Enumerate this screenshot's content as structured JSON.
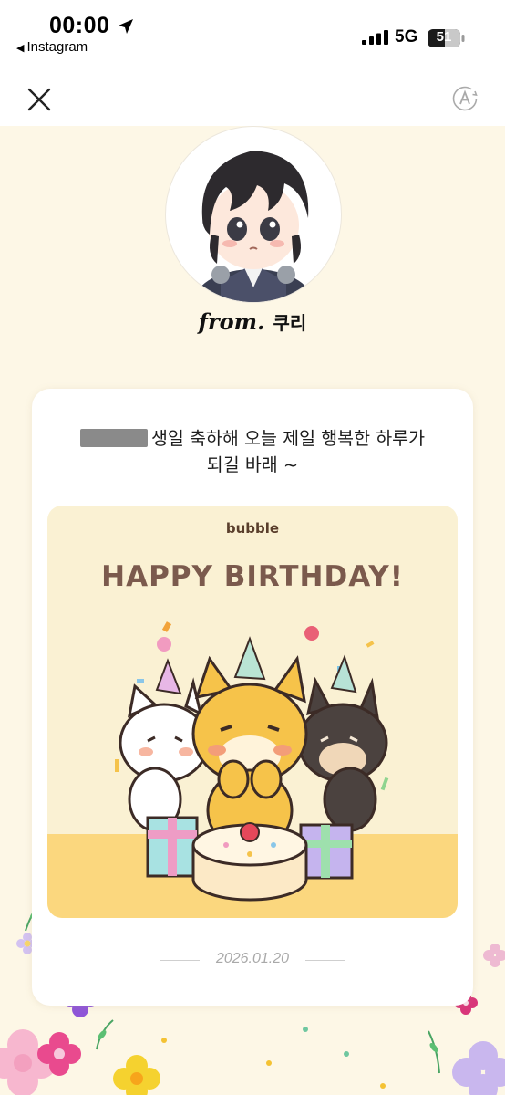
{
  "status_bar": {
    "time": "00:00",
    "back_app": "Instagram",
    "network": "5G",
    "battery": "51"
  },
  "header": {
    "close_icon": "close-icon",
    "translate_icon": "auto-translate-icon"
  },
  "sender": {
    "from_label": "from.",
    "name": "쿠리"
  },
  "card": {
    "message_line1": "생일 축하해 오늘 제일 행복한 하루가",
    "message_line2": "되길 바래 ~",
    "image_brand": "bubble",
    "image_headline": "HAPPY BIRTHDAY!",
    "date": "2026.01.20"
  },
  "colors": {
    "page_bg": "#fdf7e6",
    "card_bg": "#ffffff",
    "image_bg": "#faf1d3",
    "headline": "#7b5a4d"
  }
}
